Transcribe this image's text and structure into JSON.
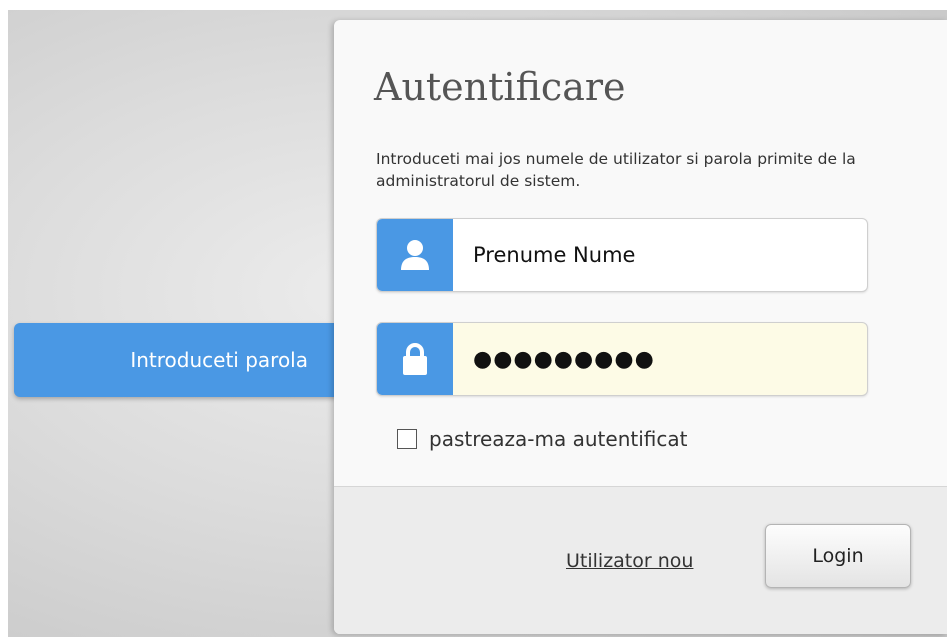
{
  "hint": {
    "label": "Introduceti parola"
  },
  "login": {
    "title": "Autentificare",
    "description": "Introduceti mai jos numele de utilizator si parola primite de la administratorul de sistem.",
    "username": {
      "value": "Prenume Nume",
      "icon": "user-icon"
    },
    "password": {
      "value": "●●●●●●●●●",
      "icon": "lock-icon"
    },
    "remember": {
      "label": "pastreaza-ma autentificat",
      "checked": false
    },
    "new_user_label": "Utilizator nou",
    "submit_label": "Login"
  },
  "colors": {
    "accent": "#4a98e4",
    "password_field_bg": "#fdfbe6",
    "card_bg": "#f9f9f9",
    "footer_bg": "#ececec"
  }
}
